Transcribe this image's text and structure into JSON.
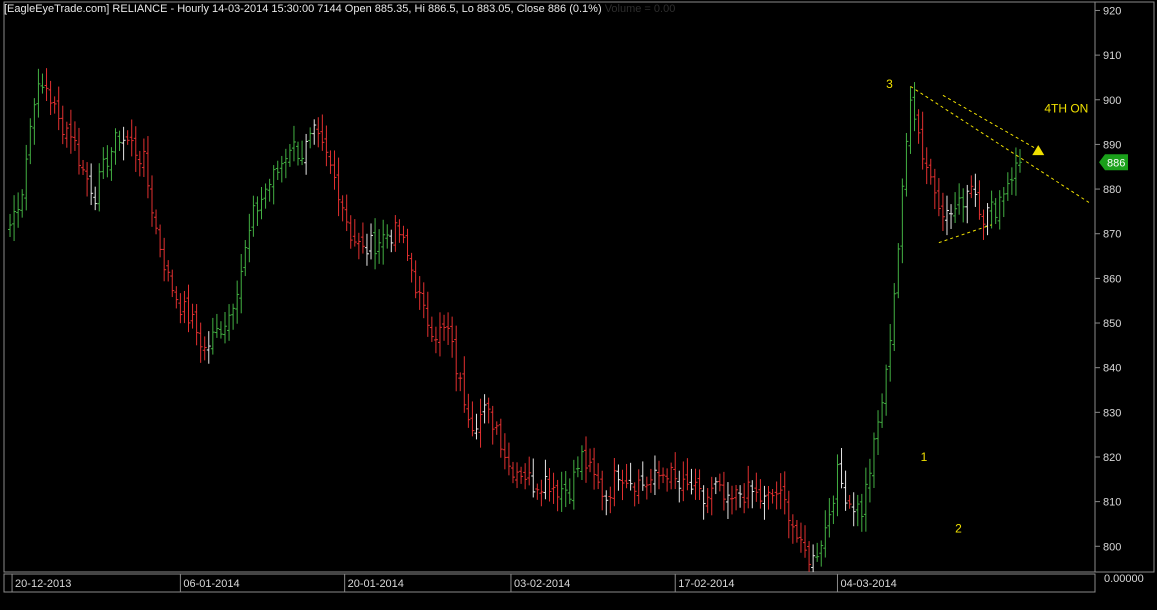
{
  "header": {
    "main_text": "[EagleEyeTrade.com] RELIANCE - Hourly 14-03-2014 15:30:00 7144 Open 885.35, Hi 886.5, Lo 883.05, Close 886 (0.1%)",
    "volume_text": "Volume = 0.00"
  },
  "price_badge": "886",
  "volume_axis_label": "0.00000",
  "colors": {
    "up": "#43b043",
    "down": "#e23030",
    "neutral": "#e8e8e8",
    "badge": "#1aa01a",
    "annotation": "#f0e000",
    "axis": "#8a8a8a"
  },
  "annotations": [
    {
      "text": "3",
      "x": 216,
      "y": 903.5
    },
    {
      "text": "1",
      "x": 224.5,
      "y": 820
    },
    {
      "text": "2",
      "x": 233,
      "y": 804
    },
    {
      "text": "4TH ON",
      "x": 255,
      "y": 898
    }
  ],
  "chart_data": {
    "type": "ohlc",
    "title": "RELIANCE - Hourly",
    "y_ticks": [
      800,
      810,
      820,
      830,
      840,
      850,
      860,
      870,
      880,
      890,
      900,
      910,
      920
    ],
    "ylim": [
      792,
      921
    ],
    "xlim": [
      -0.5,
      267
    ],
    "x_tick_labels": [
      {
        "label": "20-12-2013",
        "index": 0.5
      },
      {
        "label": "06-01-2014",
        "index": 42
      },
      {
        "label": "20-01-2014",
        "index": 82.5
      },
      {
        "label": "03-02-2014",
        "index": 123.5
      },
      {
        "label": "17-02-2014",
        "index": 164
      },
      {
        "label": "04-03-2014",
        "index": 204
      }
    ],
    "anchors": [
      [
        0,
        872
      ],
      [
        3,
        880
      ],
      [
        6,
        901
      ],
      [
        9,
        903
      ],
      [
        12,
        895
      ],
      [
        15,
        893
      ],
      [
        18,
        884
      ],
      [
        21,
        879
      ],
      [
        24,
        887
      ],
      [
        27,
        892
      ],
      [
        30,
        890
      ],
      [
        33,
        886
      ],
      [
        36,
        871
      ],
      [
        39,
        860
      ],
      [
        42,
        854
      ],
      [
        45,
        850
      ],
      [
        48,
        844
      ],
      [
        51,
        848
      ],
      [
        54,
        852
      ],
      [
        57,
        862
      ],
      [
        60,
        874
      ],
      [
        63,
        880
      ],
      [
        66,
        884
      ],
      [
        69,
        890
      ],
      [
        72,
        888
      ],
      [
        75,
        892
      ],
      [
        78,
        887
      ],
      [
        81,
        880
      ],
      [
        84,
        870
      ],
      [
        87,
        866
      ],
      [
        90,
        868
      ],
      [
        93,
        870
      ],
      [
        96,
        870
      ],
      [
        99,
        862
      ],
      [
        102,
        852
      ],
      [
        105,
        848
      ],
      [
        108,
        848
      ],
      [
        111,
        836
      ],
      [
        114,
        828
      ],
      [
        117,
        830
      ],
      [
        120,
        827
      ],
      [
        123,
        818
      ],
      [
        126,
        817
      ],
      [
        129,
        814
      ],
      [
        132,
        815
      ],
      [
        135,
        813
      ],
      [
        138,
        813
      ],
      [
        141,
        820
      ],
      [
        144,
        815
      ],
      [
        147,
        811
      ],
      [
        150,
        817
      ],
      [
        153,
        815
      ],
      [
        156,
        814
      ],
      [
        159,
        815
      ],
      [
        162,
        817
      ],
      [
        165,
        813
      ],
      [
        168,
        813
      ],
      [
        171,
        810
      ],
      [
        174,
        813
      ],
      [
        177,
        809
      ],
      [
        180,
        812
      ],
      [
        183,
        812
      ],
      [
        186,
        810
      ],
      [
        189,
        812
      ],
      [
        192,
        808
      ],
      [
        195,
        799
      ],
      [
        198,
        797
      ],
      [
        201,
        804
      ],
      [
        204,
        816
      ],
      [
        207,
        810
      ],
      [
        210,
        808
      ],
      [
        213,
        822
      ],
      [
        216,
        838
      ],
      [
        219,
        867
      ],
      [
        222,
        902
      ],
      [
        225,
        888
      ],
      [
        228,
        880
      ],
      [
        231,
        874
      ],
      [
        234,
        876
      ],
      [
        237,
        882
      ],
      [
        240,
        874
      ],
      [
        243,
        876
      ],
      [
        246,
        882
      ],
      [
        249,
        886
      ]
    ],
    "trendlines": [
      {
        "from": [
          222,
          903
        ],
        "to": [
          266,
          877
        ],
        "style": "dashed"
      },
      {
        "from": [
          230,
          901
        ],
        "to": [
          254,
          888.5
        ],
        "style": "dashed"
      },
      {
        "from": [
          229,
          868
        ],
        "to": [
          242,
          872
        ],
        "style": "dashed"
      }
    ],
    "arrow_target": [
      253.5,
      888.5
    ],
    "last_close": 886
  }
}
